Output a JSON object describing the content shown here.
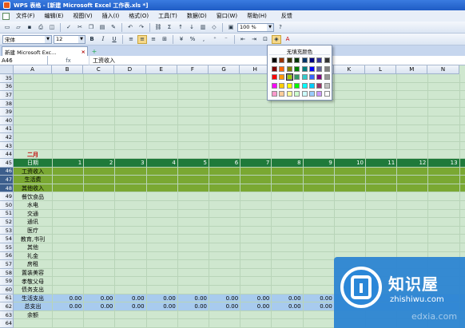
{
  "window": {
    "title": "WPS 表格 - [新建 Microsoft Excel 工作表.xls *]"
  },
  "menu": {
    "items": [
      "文件(F)",
      "编辑(E)",
      "视图(V)",
      "插入(I)",
      "格式(O)",
      "工具(T)",
      "数据(D)",
      "窗口(W)",
      "帮助(H)"
    ],
    "feedback": "反馈"
  },
  "toolbar": {
    "zoom": "100 %",
    "font_name": "宋体",
    "font_size": "12",
    "bold": "B",
    "italic": "I",
    "underline": "U"
  },
  "tabs": {
    "active_doc": "新建 Microsoft Exc...",
    "close": "×",
    "add": "+"
  },
  "formula_bar": {
    "name_box": "A46",
    "fx": "fx",
    "value": "工资收入"
  },
  "palette": {
    "no_fill": "无填充颜色",
    "colors": [
      [
        "#000000",
        "#993300",
        "#333300",
        "#003300",
        "#003366",
        "#000080",
        "#333399",
        "#333333"
      ],
      [
        "#800000",
        "#FF6600",
        "#808000",
        "#008000",
        "#008080",
        "#0000FF",
        "#666699",
        "#808080"
      ],
      [
        "#FF0000",
        "#FF9900",
        "#99CC00",
        "#339966",
        "#33CCCC",
        "#3366FF",
        "#800080",
        "#969696"
      ],
      [
        "#FF00FF",
        "#FFCC00",
        "#FFFF00",
        "#00FF00",
        "#00FFFF",
        "#00CCFF",
        "#993366",
        "#C0C0C0"
      ],
      [
        "#FF99CC",
        "#FFCC99",
        "#FFFF99",
        "#CCFFCC",
        "#CCFFFF",
        "#99CCFF",
        "#CC99FF",
        "#FFFFFF"
      ]
    ],
    "selected_color": "#99CC00"
  },
  "sheet": {
    "columns": [
      "A",
      "B",
      "C",
      "D",
      "E",
      "F",
      "G",
      "H",
      "I",
      "J",
      "K",
      "L",
      "M",
      "N"
    ],
    "rows": [
      "35",
      "36",
      "37",
      "38",
      "39",
      "40",
      "41",
      "42",
      "43",
      "44",
      "45",
      "46",
      "47",
      "48",
      "49",
      "50",
      "51",
      "52",
      "53",
      "54",
      "55",
      "56",
      "57",
      "58",
      "59",
      "60",
      "61",
      "62",
      "63",
      "64"
    ],
    "selected_rows": [
      "46",
      "47",
      "48"
    ],
    "month_label": "二月",
    "date_label": "日期",
    "day_numbers": [
      "1",
      "2",
      "3",
      "4",
      "5",
      "6",
      "7",
      "8",
      "9",
      "10",
      "11",
      "12",
      "13"
    ],
    "income_labels": [
      "工资收入",
      "生活费",
      "其他收入"
    ],
    "expense_labels": [
      "餐饮食品",
      "水电",
      "交通",
      "通讯",
      "医疗",
      "教育,书刊",
      "其他",
      "礼金",
      "房租",
      "置装美容",
      "孝敬父母",
      "债务支出"
    ],
    "summary_labels": [
      "生活支出",
      "总支出",
      "余额"
    ],
    "summary_value": "0.00"
  },
  "watermark": {
    "title": "知识屋",
    "url": "zhishiwu.com",
    "ghost": "edxia.com"
  }
}
